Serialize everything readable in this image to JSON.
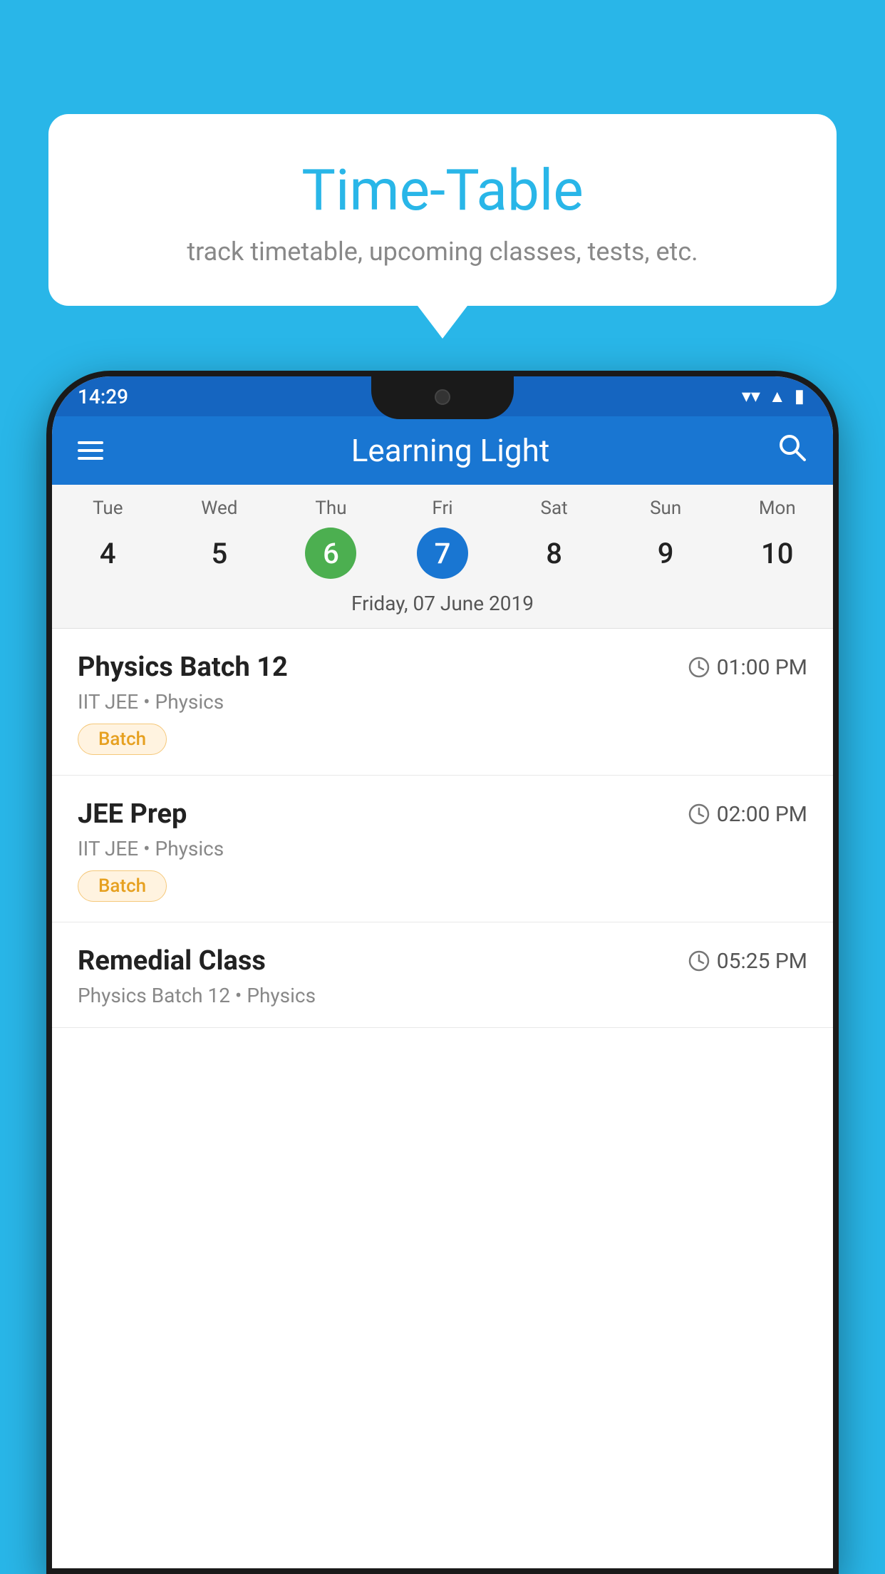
{
  "background_color": "#29b6e8",
  "tooltip": {
    "title": "Time-Table",
    "subtitle": "track timetable, upcoming classes, tests, etc."
  },
  "phone": {
    "status_bar": {
      "time": "14:29"
    },
    "app_bar": {
      "title": "Learning Light"
    },
    "calendar": {
      "days": [
        {
          "name": "Tue",
          "num": "4",
          "state": "normal"
        },
        {
          "name": "Wed",
          "num": "5",
          "state": "normal"
        },
        {
          "name": "Thu",
          "num": "6",
          "state": "today"
        },
        {
          "name": "Fri",
          "num": "7",
          "state": "selected"
        },
        {
          "name": "Sat",
          "num": "8",
          "state": "normal"
        },
        {
          "name": "Sun",
          "num": "9",
          "state": "normal"
        },
        {
          "name": "Mon",
          "num": "10",
          "state": "normal"
        }
      ],
      "selected_date_label": "Friday, 07 June 2019"
    },
    "schedule": [
      {
        "title": "Physics Batch 12",
        "time": "01:00 PM",
        "sub": "IIT JEE • Physics",
        "badge": "Batch"
      },
      {
        "title": "JEE Prep",
        "time": "02:00 PM",
        "sub": "IIT JEE • Physics",
        "badge": "Batch"
      },
      {
        "title": "Remedial Class",
        "time": "05:25 PM",
        "sub": "Physics Batch 12 • Physics",
        "badge": null
      }
    ]
  }
}
